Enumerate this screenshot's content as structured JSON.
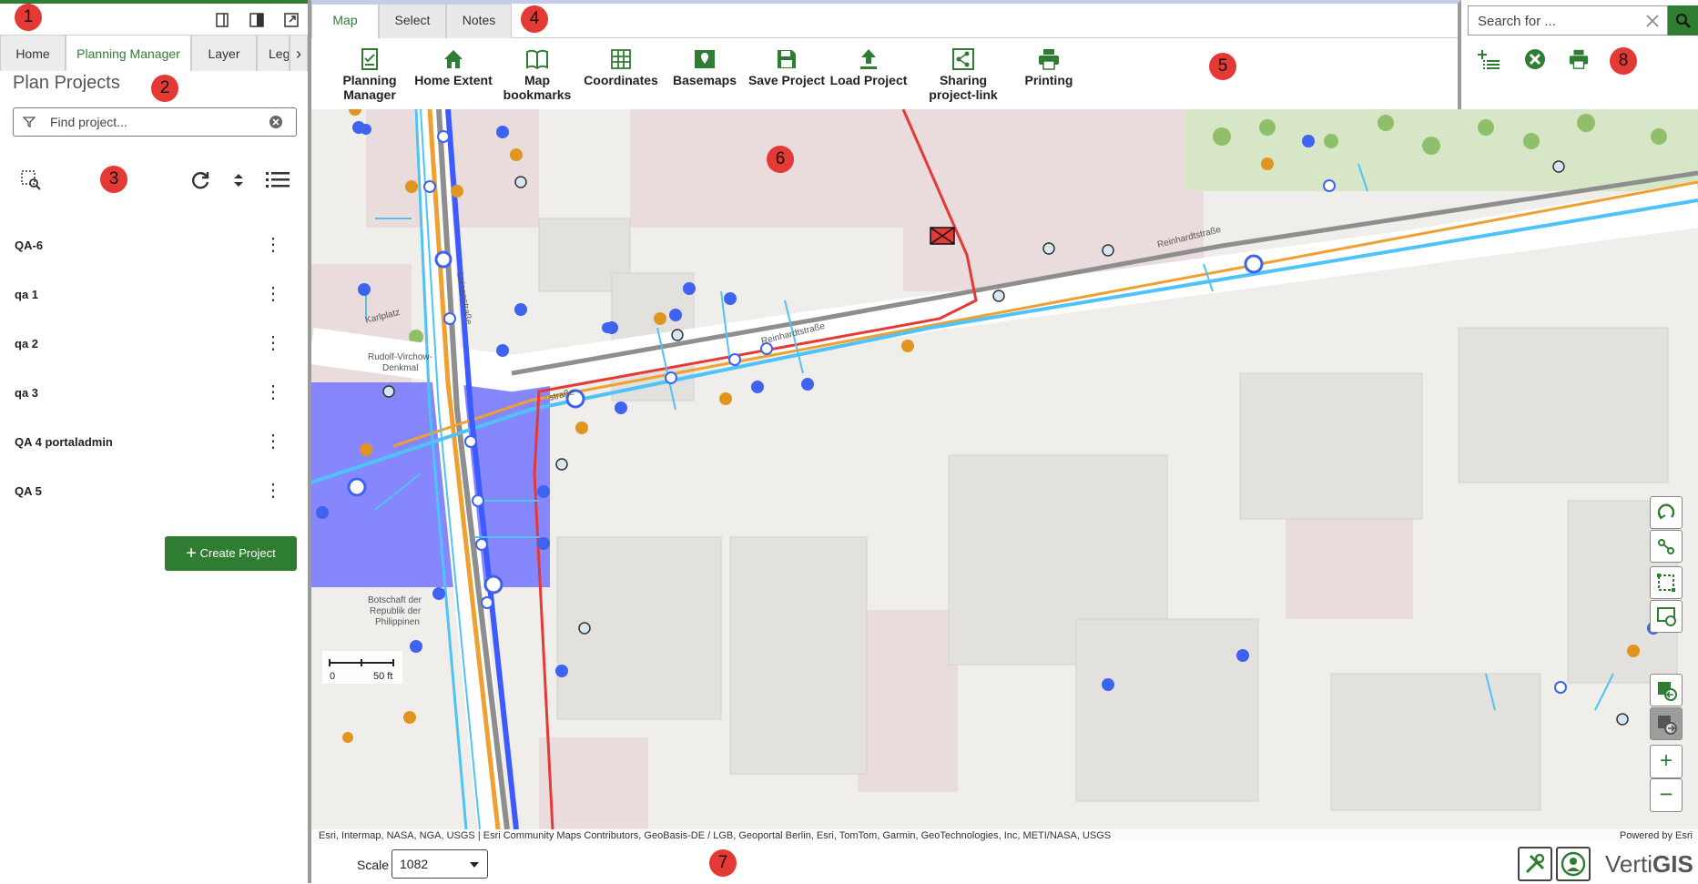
{
  "left_panel": {
    "tabs": [
      {
        "label": "Home"
      },
      {
        "label": "Planning Manager"
      },
      {
        "label": "Layer"
      },
      {
        "label": "Leg"
      }
    ],
    "title": "Plan Projects",
    "find_placeholder": "Find project...",
    "projects": [
      {
        "name": "QA-6"
      },
      {
        "name": "qa 1"
      },
      {
        "name": "qa 2"
      },
      {
        "name": "qa 3"
      },
      {
        "name": "QA 4 portaladmin"
      },
      {
        "name": "QA 5"
      }
    ],
    "create_label": "Create Project"
  },
  "ribbon": {
    "tabs": [
      {
        "label": "Map"
      },
      {
        "label": "Select"
      },
      {
        "label": "Notes"
      }
    ],
    "buttons": [
      {
        "line1": "Planning",
        "line2": "Manager",
        "icon": "planning-manager-icon"
      },
      {
        "line1": "Home Extent",
        "line2": "",
        "icon": "home-icon"
      },
      {
        "line1": "Map",
        "line2": "bookmarks",
        "icon": "book-icon"
      },
      {
        "line1": "Coordinates",
        "line2": "",
        "icon": "grid-icon"
      },
      {
        "line1": "Basemaps",
        "line2": "",
        "icon": "map-icon"
      },
      {
        "line1": "Save Project",
        "line2": "",
        "icon": "save-icon"
      },
      {
        "line1": "Load Project",
        "line2": "",
        "icon": "upload-icon"
      },
      {
        "line1": "Sharing",
        "line2": "project-link",
        "icon": "share-icon"
      },
      {
        "line1": "Printing",
        "line2": "",
        "icon": "printer-icon"
      }
    ]
  },
  "search": {
    "placeholder": "Search for ..."
  },
  "map": {
    "labels": {
      "street1": "Reinhardtstraße",
      "street2": "Reinhardtstraße",
      "place1": "Karlplatz",
      "place2": "Rudolf-Virchow-",
      "place2b": "Denkmal",
      "place3": "Botschaft der",
      "place3b": "Republik der",
      "place3c": "Philippinen",
      "street3": "Luisenstraße",
      "street4": "straße"
    },
    "scalebar_start": "0",
    "scalebar_end": "50 ft",
    "attribution": "Esri, Intermap, NASA, NGA, USGS | Esri Community Maps Contributors, GeoBasis-DE / LGB, Geoportal Berlin, Esri, TomTom, Garmin, GeoTechnologies, Inc, METI/NASA, USGS",
    "powered_by": "Powered by Esri"
  },
  "bottom": {
    "scale_label": "Scale",
    "scale_value": "1082",
    "brand_a": "Verti",
    "brand_b": "GIS"
  },
  "callouts": [
    "1",
    "2",
    "3",
    "4",
    "5",
    "6",
    "7",
    "8"
  ],
  "colors": {
    "accent": "#2e7d32",
    "callout": "#e53935",
    "water_line": "#4fc3f7",
    "gas_line": "#f0a030",
    "main_line": "#3d5afe",
    "power_line": "#e53935",
    "polygon": "#7b7bff"
  }
}
